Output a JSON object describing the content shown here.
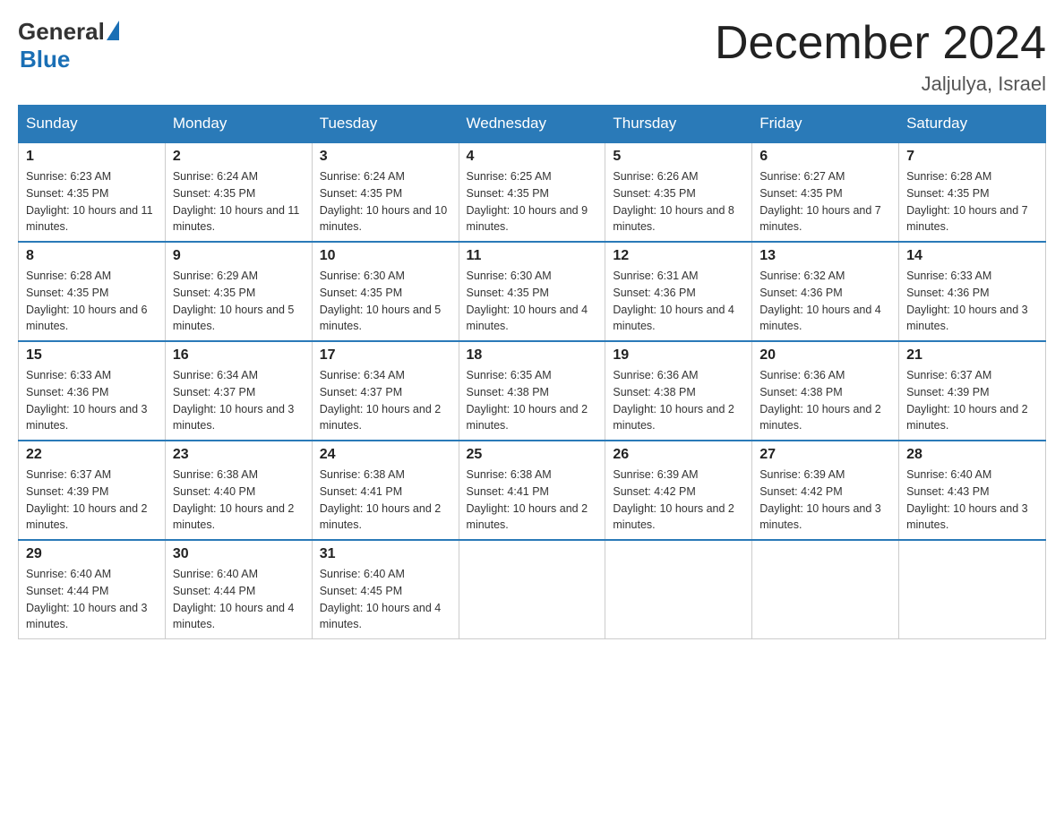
{
  "header": {
    "logo_general": "General",
    "logo_blue": "Blue",
    "month_title": "December 2024",
    "location": "Jaljulya, Israel"
  },
  "days_of_week": [
    "Sunday",
    "Monday",
    "Tuesday",
    "Wednesday",
    "Thursday",
    "Friday",
    "Saturday"
  ],
  "weeks": [
    [
      {
        "day": "1",
        "sunrise": "6:23 AM",
        "sunset": "4:35 PM",
        "daylight": "10 hours and 11 minutes."
      },
      {
        "day": "2",
        "sunrise": "6:24 AM",
        "sunset": "4:35 PM",
        "daylight": "10 hours and 11 minutes."
      },
      {
        "day": "3",
        "sunrise": "6:24 AM",
        "sunset": "4:35 PM",
        "daylight": "10 hours and 10 minutes."
      },
      {
        "day": "4",
        "sunrise": "6:25 AM",
        "sunset": "4:35 PM",
        "daylight": "10 hours and 9 minutes."
      },
      {
        "day": "5",
        "sunrise": "6:26 AM",
        "sunset": "4:35 PM",
        "daylight": "10 hours and 8 minutes."
      },
      {
        "day": "6",
        "sunrise": "6:27 AM",
        "sunset": "4:35 PM",
        "daylight": "10 hours and 7 minutes."
      },
      {
        "day": "7",
        "sunrise": "6:28 AM",
        "sunset": "4:35 PM",
        "daylight": "10 hours and 7 minutes."
      }
    ],
    [
      {
        "day": "8",
        "sunrise": "6:28 AM",
        "sunset": "4:35 PM",
        "daylight": "10 hours and 6 minutes."
      },
      {
        "day": "9",
        "sunrise": "6:29 AM",
        "sunset": "4:35 PM",
        "daylight": "10 hours and 5 minutes."
      },
      {
        "day": "10",
        "sunrise": "6:30 AM",
        "sunset": "4:35 PM",
        "daylight": "10 hours and 5 minutes."
      },
      {
        "day": "11",
        "sunrise": "6:30 AM",
        "sunset": "4:35 PM",
        "daylight": "10 hours and 4 minutes."
      },
      {
        "day": "12",
        "sunrise": "6:31 AM",
        "sunset": "4:36 PM",
        "daylight": "10 hours and 4 minutes."
      },
      {
        "day": "13",
        "sunrise": "6:32 AM",
        "sunset": "4:36 PM",
        "daylight": "10 hours and 4 minutes."
      },
      {
        "day": "14",
        "sunrise": "6:33 AM",
        "sunset": "4:36 PM",
        "daylight": "10 hours and 3 minutes."
      }
    ],
    [
      {
        "day": "15",
        "sunrise": "6:33 AM",
        "sunset": "4:36 PM",
        "daylight": "10 hours and 3 minutes."
      },
      {
        "day": "16",
        "sunrise": "6:34 AM",
        "sunset": "4:37 PM",
        "daylight": "10 hours and 3 minutes."
      },
      {
        "day": "17",
        "sunrise": "6:34 AM",
        "sunset": "4:37 PM",
        "daylight": "10 hours and 2 minutes."
      },
      {
        "day": "18",
        "sunrise": "6:35 AM",
        "sunset": "4:38 PM",
        "daylight": "10 hours and 2 minutes."
      },
      {
        "day": "19",
        "sunrise": "6:36 AM",
        "sunset": "4:38 PM",
        "daylight": "10 hours and 2 minutes."
      },
      {
        "day": "20",
        "sunrise": "6:36 AM",
        "sunset": "4:38 PM",
        "daylight": "10 hours and 2 minutes."
      },
      {
        "day": "21",
        "sunrise": "6:37 AM",
        "sunset": "4:39 PM",
        "daylight": "10 hours and 2 minutes."
      }
    ],
    [
      {
        "day": "22",
        "sunrise": "6:37 AM",
        "sunset": "4:39 PM",
        "daylight": "10 hours and 2 minutes."
      },
      {
        "day": "23",
        "sunrise": "6:38 AM",
        "sunset": "4:40 PM",
        "daylight": "10 hours and 2 minutes."
      },
      {
        "day": "24",
        "sunrise": "6:38 AM",
        "sunset": "4:41 PM",
        "daylight": "10 hours and 2 minutes."
      },
      {
        "day": "25",
        "sunrise": "6:38 AM",
        "sunset": "4:41 PM",
        "daylight": "10 hours and 2 minutes."
      },
      {
        "day": "26",
        "sunrise": "6:39 AM",
        "sunset": "4:42 PM",
        "daylight": "10 hours and 2 minutes."
      },
      {
        "day": "27",
        "sunrise": "6:39 AM",
        "sunset": "4:42 PM",
        "daylight": "10 hours and 3 minutes."
      },
      {
        "day": "28",
        "sunrise": "6:40 AM",
        "sunset": "4:43 PM",
        "daylight": "10 hours and 3 minutes."
      }
    ],
    [
      {
        "day": "29",
        "sunrise": "6:40 AM",
        "sunset": "4:44 PM",
        "daylight": "10 hours and 3 minutes."
      },
      {
        "day": "30",
        "sunrise": "6:40 AM",
        "sunset": "4:44 PM",
        "daylight": "10 hours and 4 minutes."
      },
      {
        "day": "31",
        "sunrise": "6:40 AM",
        "sunset": "4:45 PM",
        "daylight": "10 hours and 4 minutes."
      },
      null,
      null,
      null,
      null
    ]
  ]
}
